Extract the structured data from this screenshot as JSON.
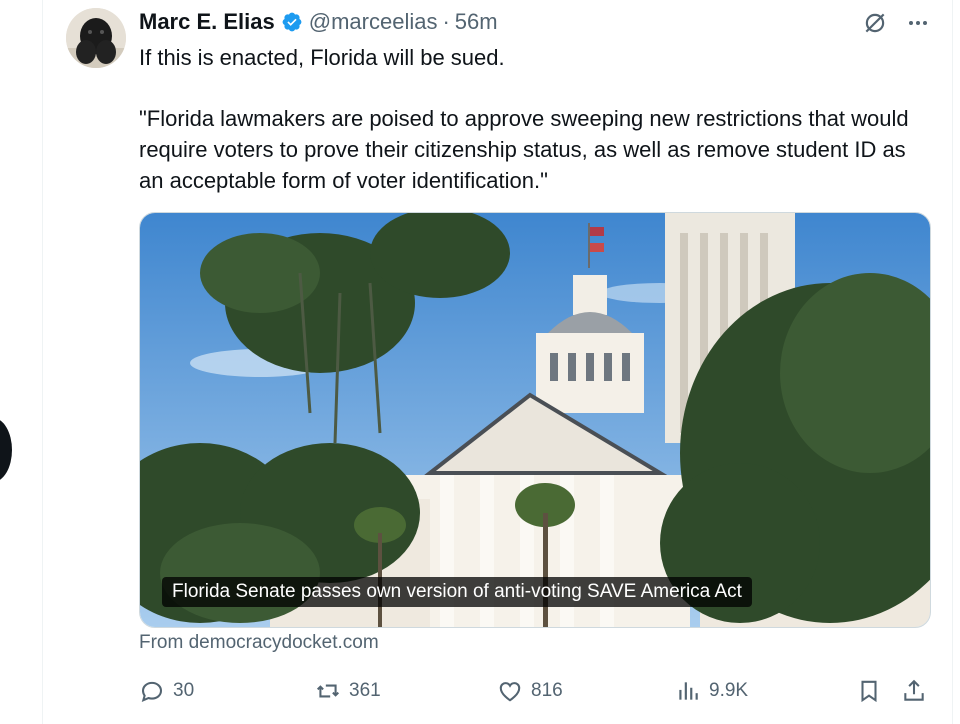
{
  "tweet": {
    "author_name": "Marc E. Elias",
    "handle": "@marceelias",
    "separator": "·",
    "time": "56m",
    "paragraphs": [
      "If this is enacted, Florida will be sued.",
      "\"Florida lawmakers are poised to approve sweeping new restrictions that would require voters to prove their citizenship status, as well as remove student ID as an acceptable form of voter identification.\""
    ],
    "card": {
      "caption": "Florida Senate passes own version of anti-voting SAVE America Act",
      "source": "From democracydocket.com"
    },
    "actions": {
      "replies": "30",
      "reposts": "361",
      "likes": "816",
      "views": "9.9K"
    }
  },
  "icons": {
    "verified": "verified-badge-icon",
    "grok": "grok-icon",
    "more": "more-icon",
    "reply": "reply-icon",
    "repost": "repost-icon",
    "like": "like-icon",
    "views": "views-icon",
    "bookmark": "bookmark-icon",
    "share": "share-icon"
  },
  "colors": {
    "text": "#0f1419",
    "secondary": "#536471",
    "verified": "#1d9bf0"
  }
}
